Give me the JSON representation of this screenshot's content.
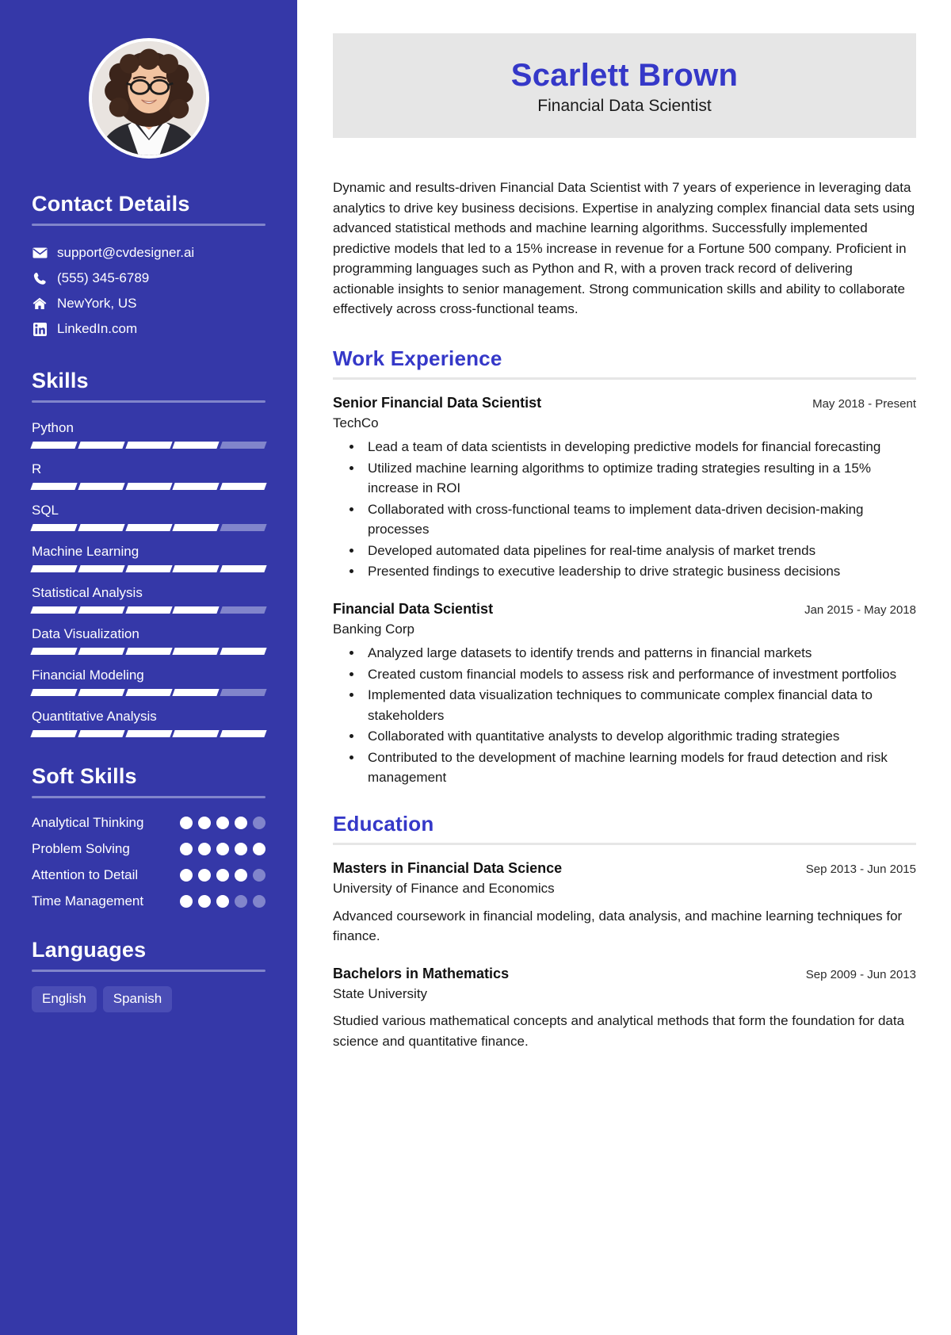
{
  "header": {
    "full_name": "Scarlett Brown",
    "job_title": "Financial Data Scientist",
    "name_color": "#3538c8",
    "card_bg": "#e6e6e6"
  },
  "sidebar": {
    "bg_color": "#3538a8",
    "accent_muted": "#8185cb",
    "avatar_alt": "profile-photo",
    "contact": {
      "title": "Contact Details",
      "items": [
        {
          "icon": "envelope-icon",
          "label": "support@cvdesigner.ai"
        },
        {
          "icon": "phone-icon",
          "label": "(555) 345-6789"
        },
        {
          "icon": "home-icon",
          "label": "NewYork, US"
        },
        {
          "icon": "linkedin-icon",
          "label": "LinkedIn.com"
        }
      ]
    },
    "skills": {
      "title": "Skills",
      "segments_total": 5,
      "items": [
        {
          "name": "Python",
          "level": 4
        },
        {
          "name": "R",
          "level": 5
        },
        {
          "name": "SQL",
          "level": 4
        },
        {
          "name": "Machine Learning",
          "level": 5
        },
        {
          "name": "Statistical Analysis",
          "level": 4
        },
        {
          "name": "Data Visualization",
          "level": 5
        },
        {
          "name": "Financial Modeling",
          "level": 4
        },
        {
          "name": "Quantitative Analysis",
          "level": 5
        }
      ]
    },
    "soft_skills": {
      "title": "Soft Skills",
      "dots_total": 5,
      "items": [
        {
          "name": "Analytical Thinking",
          "level": 4
        },
        {
          "name": "Problem Solving",
          "level": 5
        },
        {
          "name": "Attention to Detail",
          "level": 4
        },
        {
          "name": "Time Management",
          "level": 3
        }
      ]
    },
    "languages": {
      "title": "Languages",
      "items": [
        "English",
        "Spanish"
      ]
    }
  },
  "main": {
    "summary": "Dynamic and results-driven Financial Data Scientist with 7 years of experience in leveraging data analytics to drive key business decisions. Expertise in analyzing complex financial data sets using advanced statistical methods and machine learning algorithms. Successfully implemented predictive models that led to a 15% increase in revenue for a Fortune 500 company. Proficient in programming languages such as Python and R, with a proven track record of delivering actionable insights to senior management. Strong communication skills and ability to collaborate effectively across cross-functional teams.",
    "work": {
      "title": "Work Experience",
      "entries": [
        {
          "role": "Senior Financial Data Scientist",
          "org": "TechCo",
          "date": "May 2018 - Present",
          "bullets": [
            "Lead a team of data scientists in developing predictive models for financial forecasting",
            "Utilized machine learning algorithms to optimize trading strategies resulting in a 15% increase in ROI",
            "Collaborated with cross-functional teams to implement data-driven decision-making processes",
            "Developed automated data pipelines for real-time analysis of market trends",
            "Presented findings to executive leadership to drive strategic business decisions"
          ]
        },
        {
          "role": "Financial Data Scientist",
          "org": "Banking Corp",
          "date": "Jan 2015 - May 2018",
          "bullets": [
            "Analyzed large datasets to identify trends and patterns in financial markets",
            "Created custom financial models to assess risk and performance of investment portfolios",
            "Implemented data visualization techniques to communicate complex financial data to stakeholders",
            "Collaborated with quantitative analysts to develop algorithmic trading strategies",
            "Contributed to the development of machine learning models for fraud detection and risk management"
          ]
        }
      ]
    },
    "education": {
      "title": "Education",
      "entries": [
        {
          "degree": "Masters in Financial Data Science",
          "school": "University of Finance and Economics",
          "date": "Sep 2013 - Jun 2015",
          "description": "Advanced coursework in financial modeling, data analysis, and machine learning techniques for finance."
        },
        {
          "degree": "Bachelors in Mathematics",
          "school": "State University",
          "date": "Sep 2009 - Jun 2013",
          "description": "Studied various mathematical concepts and analytical methods that form the foundation for data science and quantitative finance."
        }
      ]
    }
  }
}
